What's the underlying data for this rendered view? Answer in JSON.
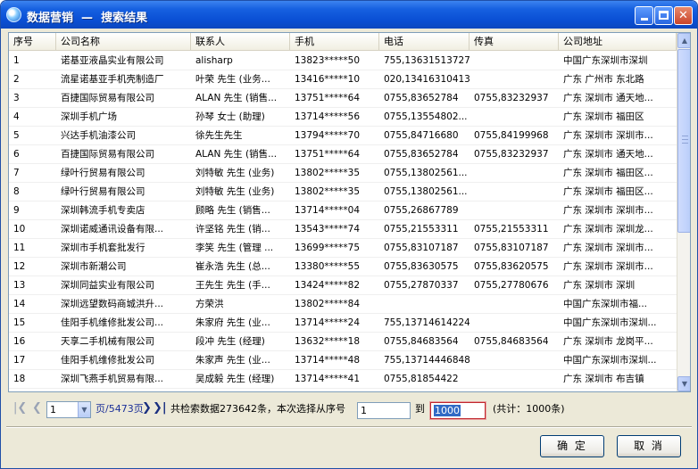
{
  "window": {
    "title": "数据营销  —  搜索结果"
  },
  "columns": [
    "序号",
    "公司名称",
    "联系人",
    "手机",
    "电话",
    "传真",
    "公司地址"
  ],
  "rows": [
    [
      "1",
      "诺基亚液晶实业有限公司",
      "alisharp",
      "13823*****50",
      "755,13631513727",
      "",
      "中国广东深圳市深圳"
    ],
    [
      "2",
      "流星诺基亚手机壳制造厂",
      "叶荣 先生 (业务...",
      "13416*****10",
      "020,13416310413",
      "",
      "广东 广州市 东北路"
    ],
    [
      "3",
      "百捷国际贸易有限公司",
      "ALAN 先生 (销售...",
      "13751*****64",
      "0755,83652784",
      "0755,83232937",
      "广东 深圳市 通天地..."
    ],
    [
      "4",
      "深圳手机广场",
      "孙琴 女士 (助理)",
      "13714*****56",
      "0755,13554802...",
      "",
      "广东 深圳市 福田区"
    ],
    [
      "5",
      "兴达手机油漆公司",
      "徐先生先生",
      "13794*****70",
      "0755,84716680",
      "0755,84199968",
      "广东 深圳市 深圳市..."
    ],
    [
      "6",
      "百捷国际贸易有限公司",
      "ALAN 先生 (销售...",
      "13751*****64",
      "0755,83652784",
      "0755,83232937",
      "广东 深圳市 通天地..."
    ],
    [
      "7",
      "绿叶行贸易有限公司",
      "刘特敏 先生 (业务)",
      "13802*****35",
      "0755,13802561...",
      "",
      "广东 深圳市 福田区..."
    ],
    [
      "8",
      "绿叶行贸易有限公司",
      "刘特敏 先生 (业务)",
      "13802*****35",
      "0755,13802561...",
      "",
      "广东 深圳市 福田区..."
    ],
    [
      "9",
      "深圳韩流手机专卖店",
      "顾略 先生 (销售...",
      "13714*****04",
      "0755,26867789",
      "",
      "广东 深圳市 深圳市..."
    ],
    [
      "10",
      "深圳诺威通讯设备有限...",
      "许坚铭 先生 (销...",
      "13543*****74",
      "0755,21553311",
      "0755,21553311",
      "广东 深圳市 深圳龙..."
    ],
    [
      "11",
      "深圳市手机套批发行",
      "李笑 先生 (管理 ...",
      "13699*****75",
      "0755,83107187",
      "0755,83107187",
      "广东 深圳市 深圳市..."
    ],
    [
      "12",
      "深圳市新潮公司",
      "崔永浩 先生 (总...",
      "13380*****55",
      "0755,83630575",
      "0755,83620575",
      "广东 深圳市 深圳市..."
    ],
    [
      "13",
      "深圳同益实业有限公司",
      "王先生 先生 (手...",
      "13424*****82",
      "0755,27870337",
      "0755,27780676",
      "广东 深圳市 深圳"
    ],
    [
      "14",
      "深圳远望数码商城洪升...",
      "方荣洪",
      "13802*****84",
      "",
      "",
      "中国广东深圳市福..."
    ],
    [
      "15",
      "佳阳手机维修批发公司...",
      "朱家府 先生 (业...",
      "13714*****24",
      "755,13714614224",
      "",
      "中国广东深圳市深圳..."
    ],
    [
      "16",
      "天享二手机械有限公司",
      "段冲 先生 (经理)",
      "13632*****18",
      "0755,84683564",
      "0755,84683564",
      "广东 深圳市 龙岗平..."
    ],
    [
      "17",
      "佳阳手机维修批发公司",
      "朱家声 先生 (业...",
      "13714*****48",
      "755,13714446848",
      "",
      "中国广东深圳市深圳..."
    ],
    [
      "18",
      "深圳飞燕手机贸易有限...",
      "吴成毅 先生 (经理)",
      "13714*****41",
      "0755,81854422",
      "",
      "广东 深圳市 布吉镇"
    ]
  ],
  "pager": {
    "page_value": "1",
    "page_total_text": "页/5473页",
    "summary_text": "共检索数据273642条，本次选择从序号",
    "from_value": "1",
    "to_label": "到",
    "to_value": "1000",
    "count_text": "(共计：1000条)"
  },
  "buttons": {
    "ok": "确 定",
    "cancel": "取 消"
  },
  "colors": {
    "titlebar": "#0a4fd4",
    "link_blue": "#1a2f99",
    "highlight_border": "#c0272d"
  }
}
